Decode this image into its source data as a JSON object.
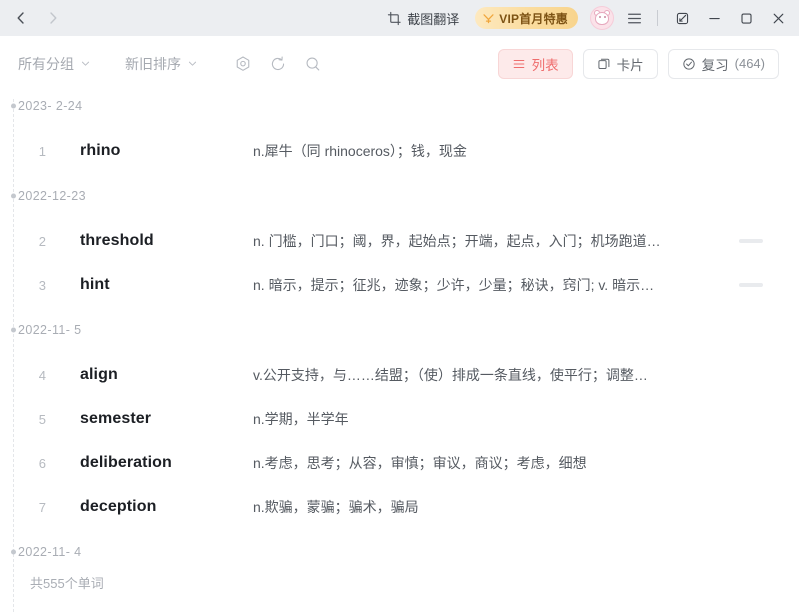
{
  "titlebar": {
    "back_icon": "chevron-left-icon",
    "forward_icon": "chevron-right-icon",
    "screenshot_translate": "截图翻译",
    "vip_label": "VIP首月特惠",
    "menu_icon": "hamburger-menu-icon",
    "avatar_icon": "user-avatar-icon",
    "restore_icon": "restore-window-icon",
    "minimize_icon": "minimize-icon",
    "maximize_icon": "maximize-icon",
    "close_icon": "close-icon"
  },
  "toolbar": {
    "group_filter": "所有分组",
    "sort_filter": "新旧排序",
    "settings_icon": "settings-icon",
    "refresh_icon": "refresh-icon",
    "search_icon": "search-icon",
    "view_list": "列表",
    "view_card": "卡片",
    "review_label": "复习",
    "review_count": "(464)",
    "accent_color": "#ef6d6d",
    "accent_bg": "#fdeaea"
  },
  "groups": [
    {
      "date": "2023- 2-24",
      "words": [
        {
          "index": "1",
          "term": "rhino",
          "definition": "n.犀牛（同 rhinoceros）；钱，现金",
          "bar": false
        }
      ]
    },
    {
      "date": "2022-12-23",
      "words": [
        {
          "index": "2",
          "term": "threshold",
          "definition": "n. 门槛，门口；阈，界，起始点；开端，起点，入门；机场跑道…",
          "bar": true
        },
        {
          "index": "3",
          "term": "hint",
          "definition": "n. 暗示，提示；征兆，迹象；少许，少量；秘诀，窍门; v. 暗示…",
          "bar": true
        }
      ]
    },
    {
      "date": "2022-11- 5",
      "words": [
        {
          "index": "4",
          "term": "align",
          "definition": "v.公开支持，与……结盟；（使）排成一条直线，使平行；调整…",
          "bar": false
        },
        {
          "index": "5",
          "term": "semester",
          "definition": "n.学期，半学年",
          "bar": false
        },
        {
          "index": "6",
          "term": "deliberation",
          "definition": "n.考虑，思考；从容，审慎；审议，商议；考虑，细想",
          "bar": false
        },
        {
          "index": "7",
          "term": "deception",
          "definition": "n.欺骗，蒙骗；骗术，骗局",
          "bar": false
        }
      ]
    },
    {
      "date": "2022-11- 4",
      "words": []
    }
  ],
  "footer": {
    "total": "共555个单词"
  }
}
